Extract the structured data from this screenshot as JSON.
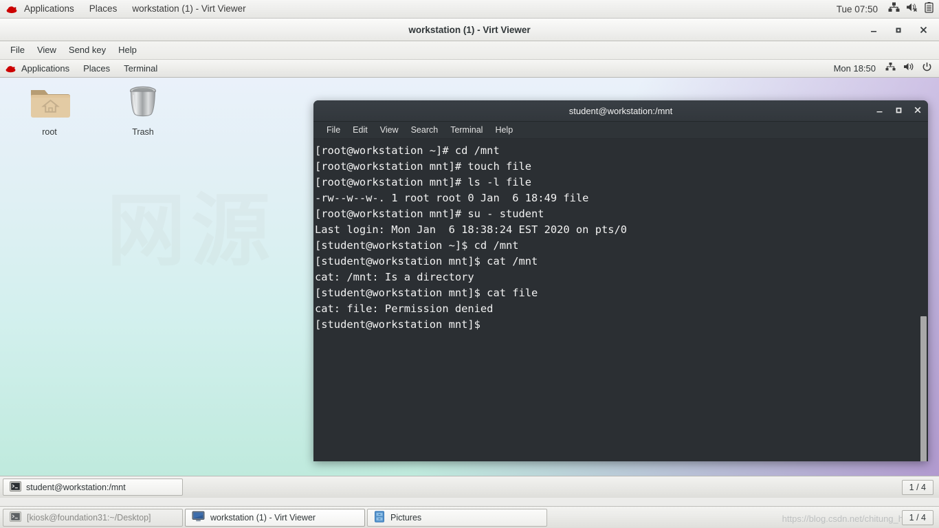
{
  "host_panel": {
    "logo": "redhat-logo",
    "menus": [
      {
        "label": "Applications",
        "name": "host-applications-menu"
      },
      {
        "label": "Places",
        "name": "host-places-menu"
      },
      {
        "label": "workstation (1) - Virt Viewer",
        "name": "host-window-menu"
      }
    ],
    "clock": "Tue 07:50",
    "tray": [
      {
        "name": "network-icon"
      },
      {
        "name": "volume-muted-icon"
      },
      {
        "name": "battery-icon"
      }
    ]
  },
  "virt_viewer": {
    "title": "workstation (1) - Virt Viewer",
    "window_buttons": [
      {
        "name": "minimize-button",
        "glyph": "–"
      },
      {
        "name": "maximize-button",
        "glyph": "□"
      },
      {
        "name": "close-button",
        "glyph": "✕"
      }
    ],
    "menus": [
      {
        "label": "File",
        "name": "vv-menu-file"
      },
      {
        "label": "View",
        "name": "vv-menu-view"
      },
      {
        "label": "Send key",
        "name": "vv-menu-send-key"
      },
      {
        "label": "Help",
        "name": "vv-menu-help"
      }
    ]
  },
  "guest_panel": {
    "logo": "redhat-logo",
    "menus": [
      {
        "label": "Applications",
        "name": "guest-applications-menu"
      },
      {
        "label": "Places",
        "name": "guest-places-menu"
      },
      {
        "label": "Terminal",
        "name": "guest-terminal-menu"
      }
    ],
    "clock": "Mon 18:50",
    "tray": [
      {
        "name": "network-icon"
      },
      {
        "name": "volume-icon"
      },
      {
        "name": "power-icon"
      }
    ]
  },
  "desktop": {
    "icons": [
      {
        "label": "root",
        "name": "desktop-icon-root",
        "icon": "home-folder-icon"
      },
      {
        "label": "Trash",
        "name": "desktop-icon-trash",
        "icon": "trash-icon"
      }
    ],
    "watermark": "网源"
  },
  "terminal": {
    "title": "student@workstation:/mnt",
    "window_buttons": [
      {
        "name": "minimize-button",
        "glyph": "–"
      },
      {
        "name": "maximize-button",
        "glyph": "□"
      },
      {
        "name": "close-button",
        "glyph": "✕"
      }
    ],
    "menus": [
      {
        "label": "File",
        "name": "term-menu-file"
      },
      {
        "label": "Edit",
        "name": "term-menu-edit"
      },
      {
        "label": "View",
        "name": "term-menu-view"
      },
      {
        "label": "Search",
        "name": "term-menu-search"
      },
      {
        "label": "Terminal",
        "name": "term-menu-terminal"
      },
      {
        "label": "Help",
        "name": "term-menu-help"
      }
    ],
    "lines": [
      "[root@workstation ~]# cd /mnt",
      "[root@workstation mnt]# touch file",
      "[root@workstation mnt]# ls -l file",
      "-rw--w--w-. 1 root root 0 Jan  6 18:49 file",
      "[root@workstation mnt]# su - student",
      "Last login: Mon Jan  6 18:38:24 EST 2020 on pts/0",
      "[student@workstation ~]$ cd /mnt",
      "[student@workstation mnt]$ cat /mnt",
      "cat: /mnt: Is a directory",
      "[student@workstation mnt]$ cat file",
      "cat: file: Permission denied",
      "[student@workstation mnt]$ "
    ],
    "text_color": "#f2f2f2",
    "background_color": "#2b2f33"
  },
  "guest_taskbar": {
    "tasks": [
      {
        "label": "student@workstation:/mnt",
        "name": "guest-task-terminal",
        "icon": "terminal-icon"
      }
    ],
    "workspace": "1 / 4"
  },
  "host_taskbar": {
    "tasks": [
      {
        "label": "[kiosk@foundation31:~/Desktop]",
        "name": "host-task-kiosk-terminal",
        "icon": "terminal-icon",
        "state": "minimized"
      },
      {
        "label": "workstation (1) - Virt Viewer",
        "name": "host-task-virt-viewer",
        "icon": "display-icon",
        "state": "active"
      },
      {
        "label": "Pictures",
        "name": "host-task-pictures",
        "icon": "file-manager-icon",
        "state": "normal"
      }
    ],
    "workspace": "1 / 4",
    "watermark": "https://blog.csdn.net/chitung_h"
  }
}
